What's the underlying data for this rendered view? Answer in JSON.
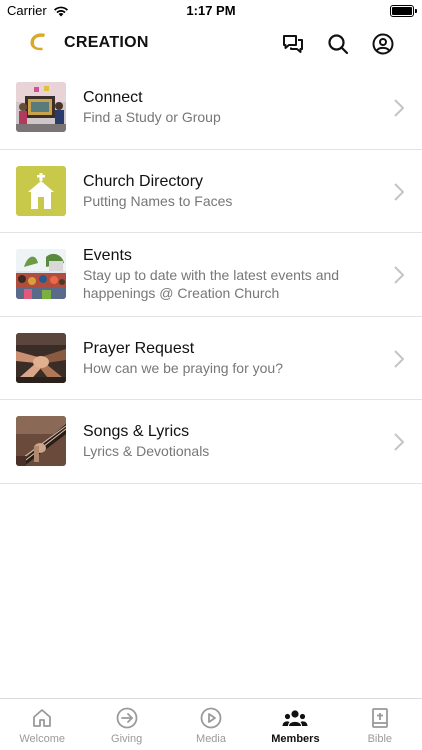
{
  "status_bar": {
    "carrier": "Carrier",
    "time": "1:17 PM"
  },
  "header": {
    "brand": "CREATION",
    "logo_color": "#d9a826"
  },
  "items": [
    {
      "title": "Connect",
      "subtitle": "Find a Study or Group",
      "icon": "connect-photo"
    },
    {
      "title": "Church Directory",
      "subtitle": "Putting Names to Faces",
      "icon": "church-icon",
      "tile_color": "#c8c94a"
    },
    {
      "title": "Events",
      "subtitle": "Stay up to date with the latest events and happenings @ Creation Church",
      "icon": "events-photo"
    },
    {
      "title": "Prayer Request",
      "subtitle": "How can we be praying for you?",
      "icon": "prayer-photo"
    },
    {
      "title": "Songs & Lyrics",
      "subtitle": "Lyrics & Devotionals",
      "icon": "guitar-photo"
    }
  ],
  "tabs": [
    {
      "label": "Welcome",
      "icon": "home-icon"
    },
    {
      "label": "Giving",
      "icon": "arrow-circle-icon"
    },
    {
      "label": "Media",
      "icon": "play-circle-icon"
    },
    {
      "label": "Members",
      "icon": "people-icon",
      "active": true
    },
    {
      "label": "Bible",
      "icon": "bible-icon"
    }
  ]
}
